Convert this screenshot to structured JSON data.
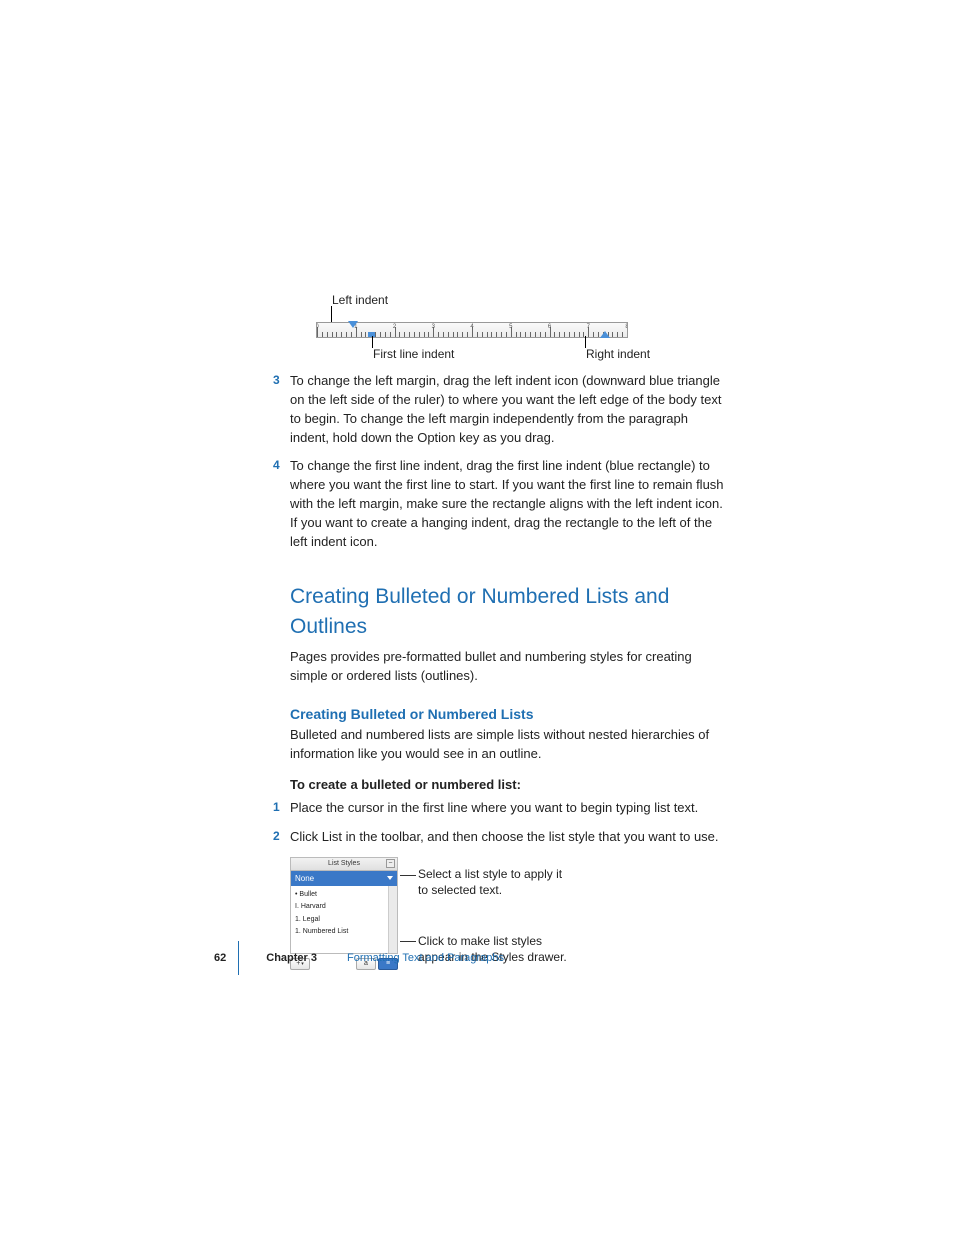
{
  "ruler": {
    "labels": {
      "left_indent": "Left indent",
      "first_line_indent": "First line indent",
      "right_indent": "Right indent"
    },
    "tick_numbers": [
      "0",
      "1",
      "2",
      "3",
      "4",
      "5",
      "6",
      "7",
      "8"
    ]
  },
  "steps_top": [
    {
      "num": "3",
      "text": "To change the left margin, drag the left indent icon (downward blue triangle on the left side of the ruler) to where you want the left edge of the body text to begin. To change the left margin independently from the paragraph indent, hold down the Option key as you drag."
    },
    {
      "num": "4",
      "text": "To change the first line indent, drag the first line indent (blue rectangle) to where you want the first line to start. If you want the first line to remain flush with the left margin, make sure the rectangle aligns with the left indent icon. If you want to create a hanging indent, drag the rectangle to the left of the left indent icon."
    }
  ],
  "section": {
    "heading": "Creating Bulleted or Numbered Lists and Outlines",
    "intro": "Pages provides pre-formatted bullet and numbering styles for creating simple or ordered lists (outlines).",
    "sub": {
      "heading": "Creating Bulleted or Numbered Lists",
      "body": "Bulleted and numbered lists are simple lists without nested hierarchies of information like you would see in an outline.",
      "howto_lead": "To create a bulleted or numbered list:",
      "steps": [
        {
          "num": "1",
          "text": "Place the cursor in the first line where you want to begin typing list text."
        },
        {
          "num": "2",
          "text": "Click List in the toolbar, and then choose the list style that you want to use."
        }
      ]
    }
  },
  "panel": {
    "header": "List Styles",
    "selected": "None",
    "items": [
      "• Bullet",
      "I. Harvard",
      "1. Legal",
      "1. Numbered List"
    ],
    "add_label": "+",
    "callouts": {
      "top": "Select a list style to apply it to selected text.",
      "bottom": "Click to make list styles appear in the Styles drawer."
    }
  },
  "footer": {
    "page": "62",
    "chapter_label": "Chapter 3",
    "chapter_title": "Formatting Text and Paragraphs"
  }
}
